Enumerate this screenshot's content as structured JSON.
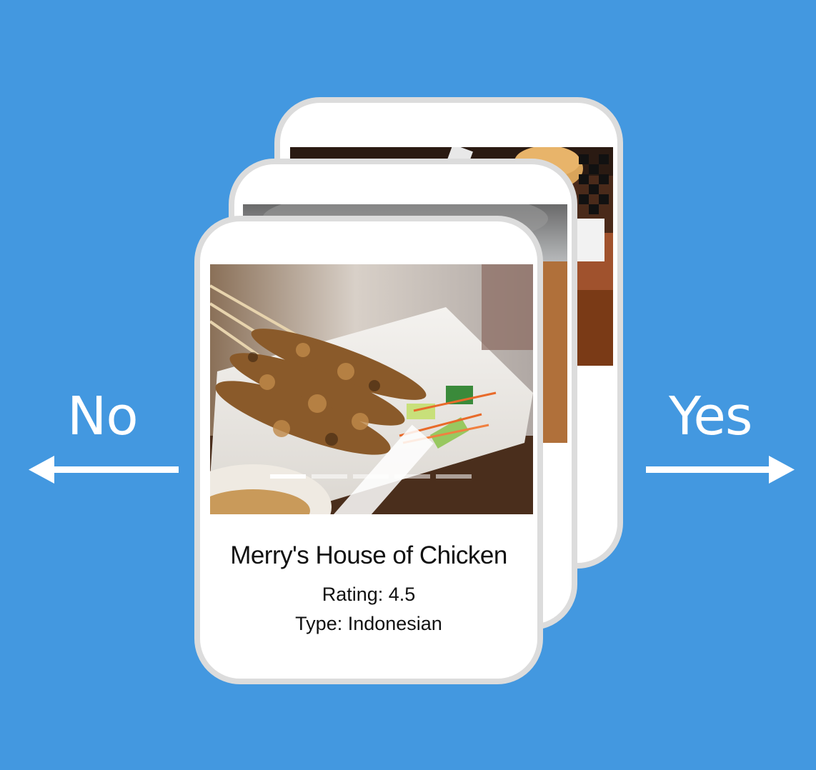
{
  "swipe": {
    "no_label": "No",
    "yes_label": "Yes"
  },
  "colors": {
    "background": "#4398e0",
    "card_border": "#dcdcdc",
    "text": "#111111"
  },
  "front_card": {
    "name": "Merry's House of Chicken",
    "rating_text": "Rating: 4.5",
    "type_text": "Type: Indonesian",
    "photo_icon": "satay-photo",
    "photo_count": 5,
    "active_photo": 1
  },
  "stack": {
    "middle_photo_icon": "blurred-food-photo",
    "back_photo_icon": "burger-basket-photo"
  }
}
